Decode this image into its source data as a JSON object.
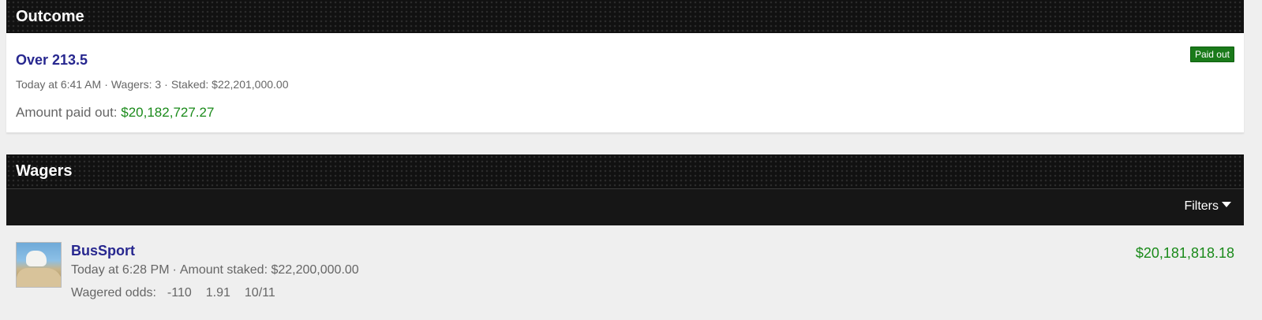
{
  "outcome": {
    "header": "Outcome",
    "title": "Over 213.5",
    "time": "Today at 6:41 AM",
    "wagers": "Wagers: 3",
    "staked": "Staked: $22,201,000.00",
    "paid_label": "Amount paid out:",
    "paid_value": "$20,182,727.27",
    "badge": "Paid out",
    "badge_color": "#1a7a1a"
  },
  "wagers": {
    "header": "Wagers",
    "filters_label": "Filters",
    "rows": [
      {
        "user": "BusSport",
        "time": "Today at 6:28 PM",
        "staked": "Amount staked: $22,200,000.00",
        "odds_label": "Wagered odds:",
        "odds_american": "-110",
        "odds_decimal": "1.91",
        "odds_fractional": "10/11",
        "amount": "$20,181,818.18",
        "avatar_icon": "goat-avatar"
      }
    ]
  },
  "colors": {
    "link": "#27278f",
    "money": "#1a8a1a",
    "header_bg": "#111111"
  }
}
